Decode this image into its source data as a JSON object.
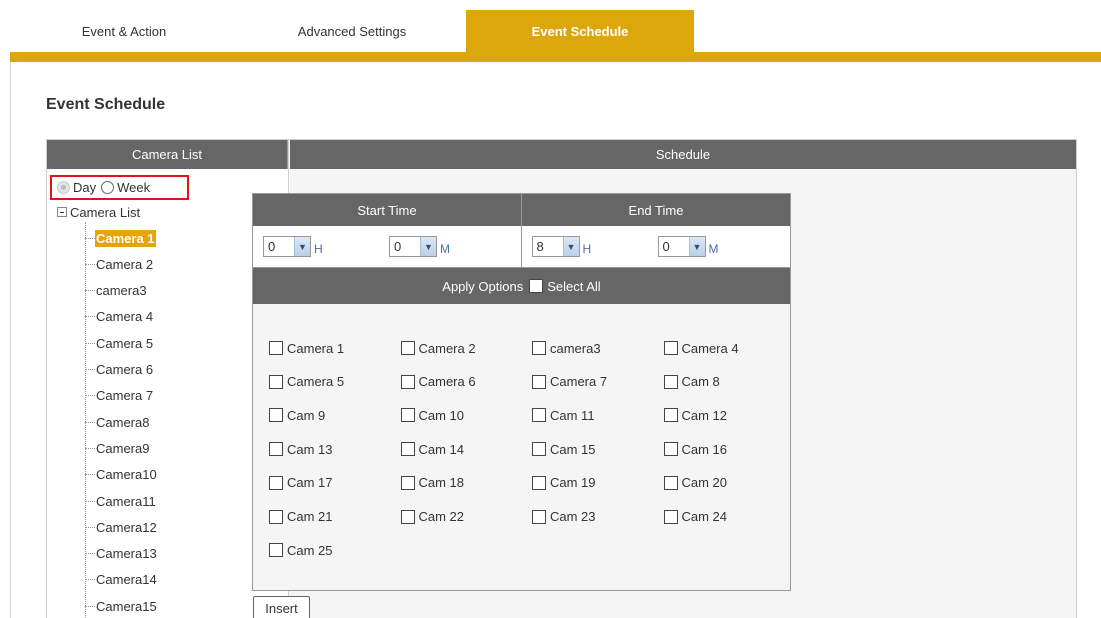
{
  "tabs": [
    {
      "label": "Event & Action",
      "active": false
    },
    {
      "label": "Advanced Settings",
      "active": false
    },
    {
      "label": "Event Schedule",
      "active": true
    }
  ],
  "page_title": "Event Schedule",
  "columns": {
    "left": "Camera List",
    "right": "Schedule"
  },
  "mode": {
    "day_label": "Day",
    "week_label": "Week",
    "selected": "Day"
  },
  "tree": {
    "root_label": "Camera List",
    "items": [
      "Camera 1",
      "Camera 2",
      "camera3",
      "Camera 4",
      "Camera 5",
      "Camera 6",
      "Camera 7",
      "Camera8",
      "Camera9",
      "Camera10",
      "Camera11",
      "Camera12",
      "Camera13",
      "Camera14",
      "Camera15"
    ],
    "selected": "Camera 1"
  },
  "schedule": {
    "start_time_label": "Start Time",
    "end_time_label": "End Time",
    "start_hour": "0",
    "start_minute": "0",
    "end_hour": "8",
    "end_minute": "0",
    "hour_unit": "H",
    "minute_unit": "M",
    "apply_options_label": "Apply Options",
    "select_all_label": "Select All",
    "cameras": [
      "Camera 1",
      "Camera 2",
      "camera3",
      "Camera 4",
      "Camera 5",
      "Camera 6",
      "Camera 7",
      "Cam 8",
      "Cam 9",
      "Cam 10",
      "Cam 11",
      "Cam 12",
      "Cam 13",
      "Cam 14",
      "Cam 15",
      "Cam 16",
      "Cam 17",
      "Cam 18",
      "Cam 19",
      "Cam 20",
      "Cam 21",
      "Cam 22",
      "Cam 23",
      "Cam 24",
      "Cam 25"
    ]
  },
  "insert_label": "Insert",
  "colors": {
    "accent": "#dba70b",
    "header_gray": "#666666",
    "highlight_red": "#e0131a"
  }
}
